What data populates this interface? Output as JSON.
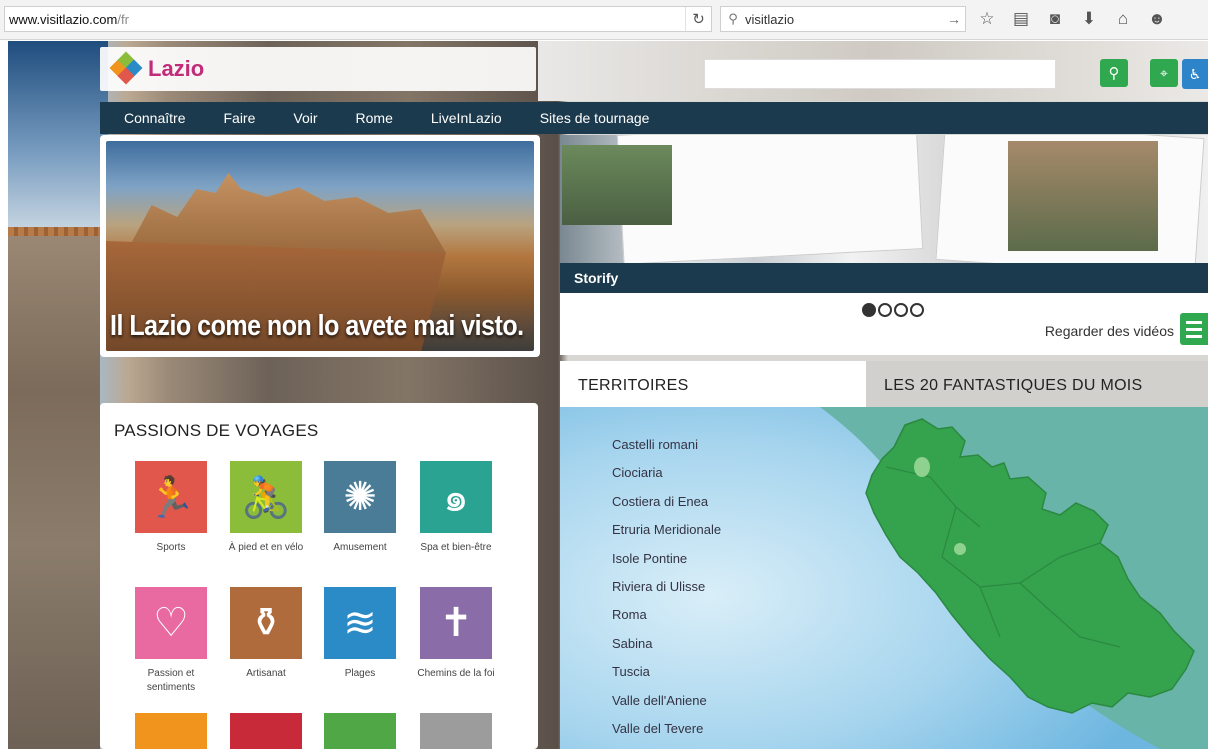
{
  "browser": {
    "url_host": "www.visitlazio.com",
    "url_path": "/fr",
    "search_query": "visitlazio",
    "icons": [
      "arrow-right-icon",
      "star-icon",
      "reader-icon",
      "pocket-icon",
      "download-icon",
      "home-icon",
      "chat-icon"
    ]
  },
  "header": {
    "logo_text": "Lazio"
  },
  "nav": {
    "items": [
      "Connaître",
      "Faire",
      "Voir",
      "Rome",
      "LiveInLazio",
      "Sites de tournage"
    ]
  },
  "hero": {
    "caption": "Il Lazio come non lo avete mai visto."
  },
  "carousel": {
    "caption": "Storify",
    "dots": 4,
    "active_dot": 0,
    "videos_label": "Regarder des vidéos"
  },
  "passions": {
    "title": "PASSIONS DE VOYAGES",
    "items": [
      {
        "label": "Sports",
        "color": "#e2574c",
        "icon": "runner-icon"
      },
      {
        "label": "À pied et en vélo",
        "color": "#8cbd3a",
        "icon": "hiker-cyclist-icon"
      },
      {
        "label": "Amusement",
        "color": "#4a7c97",
        "icon": "sun-gear-icon"
      },
      {
        "label": "Spa et bien-être",
        "color": "#2aa393",
        "icon": "spiral-stones-icon"
      },
      {
        "label": "Passion et sentiments",
        "color": "#e86aa1",
        "icon": "heart-spiral-icon"
      },
      {
        "label": "Artisanat",
        "color": "#b06b3c",
        "icon": "vase-icon"
      },
      {
        "label": "Plages",
        "color": "#2a8bc7",
        "icon": "waves-icon"
      },
      {
        "label": "Chemins de la foi",
        "color": "#8a6ca8",
        "icon": "cross-icon"
      },
      {
        "label": "",
        "color": "#f0941e",
        "icon": "tile-orange-icon"
      },
      {
        "label": "",
        "color": "#c92a3a",
        "icon": "tile-red-icon"
      },
      {
        "label": "",
        "color": "#4fa845",
        "icon": "tile-green-icon"
      },
      {
        "label": "",
        "color": "#9c9c9c",
        "icon": "castle-icon"
      }
    ]
  },
  "tabs": {
    "territories": "TERRITOIRES",
    "fantastic": "LES 20 FANTASTIQUES DU MOIS"
  },
  "territories": [
    "Castelli romani",
    "Ciociaria",
    "Costiera di Enea",
    "Etruria Meridionale",
    "Isole Pontine",
    "Riviera di Ulisse",
    "Roma",
    "Sabina",
    "Tuscia",
    "Valle dell'Aniene",
    "Valle del Tevere"
  ]
}
